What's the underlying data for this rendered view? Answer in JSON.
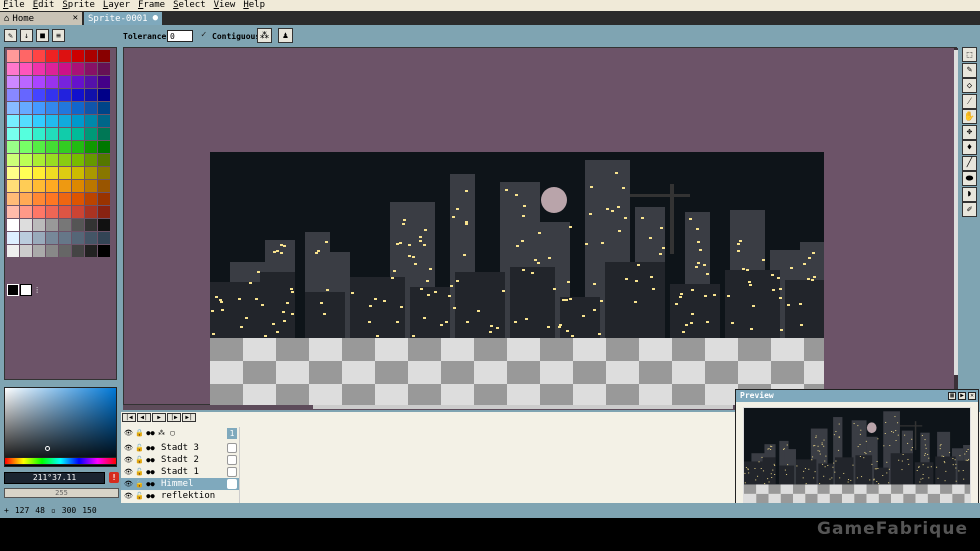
{
  "menu": {
    "items": [
      "File",
      "Edit",
      "Sprite",
      "Layer",
      "Frame",
      "Select",
      "View",
      "Help"
    ]
  },
  "tabs": {
    "home": "Home",
    "sprite": "Sprite-0001"
  },
  "toolbar": {
    "tolerance_label": "Tolerance:",
    "tolerance_value": "0",
    "contiguous_label": "Contiguous"
  },
  "palette": {
    "colors": [
      "#ff9999",
      "#ff6666",
      "#ff4444",
      "#ee2222",
      "#dd1111",
      "#cc0000",
      "#aa0000",
      "#880000",
      "#ff77cc",
      "#ff55bb",
      "#ee33aa",
      "#dd2299",
      "#cc1188",
      "#aa1177",
      "#881166",
      "#661155",
      "#cc88ff",
      "#bb66ff",
      "#aa44ff",
      "#9933ee",
      "#7722dd",
      "#6611cc",
      "#5511aa",
      "#440088",
      "#8888ff",
      "#6666ff",
      "#4444ff",
      "#3333ee",
      "#2222dd",
      "#1111cc",
      "#1111aa",
      "#000088",
      "#88bbff",
      "#66aaff",
      "#4499ff",
      "#3388ee",
      "#2277dd",
      "#1166cc",
      "#1155aa",
      "#004488",
      "#77eeff",
      "#55ddff",
      "#33ccff",
      "#22bbee",
      "#11aadd",
      "#0099cc",
      "#0088aa",
      "#006688",
      "#77ffee",
      "#55ffdd",
      "#33eecc",
      "#22ddbb",
      "#11ccaa",
      "#00bb99",
      "#009977",
      "#007755",
      "#99ff88",
      "#77ff66",
      "#55ee44",
      "#44dd33",
      "#33cc22",
      "#22bb11",
      "#119900",
      "#007700",
      "#ccff77",
      "#bbff55",
      "#aaee33",
      "#99dd22",
      "#88cc11",
      "#77bb00",
      "#669900",
      "#557700",
      "#ffff88",
      "#ffff55",
      "#ffee33",
      "#eedd22",
      "#ddcc11",
      "#ccbb00",
      "#aa9900",
      "#887700",
      "#ffdd77",
      "#ffcc55",
      "#ffbb33",
      "#ffaa22",
      "#ee9911",
      "#dd8800",
      "#bb7700",
      "#995500",
      "#ffbb77",
      "#ffaa55",
      "#ff8833",
      "#ff7722",
      "#ee6611",
      "#dd5500",
      "#bb4400",
      "#993300",
      "#ffbbaa",
      "#ff9988",
      "#ff7766",
      "#ee6655",
      "#dd5544",
      "#cc4433",
      "#aa3322",
      "#882211",
      "#ffffff",
      "#dddddd",
      "#bbbbbb",
      "#999999",
      "#777777",
      "#555555",
      "#333333",
      "#111111",
      "#ddeeff",
      "#bbccdd",
      "#99aabb",
      "#778899",
      "#667788",
      "#556677",
      "#445566",
      "#334455",
      "#eeeeee",
      "#cccccc",
      "#aaaaaa",
      "#888888",
      "#666666",
      "#444444",
      "#222222",
      "#000000"
    ]
  },
  "color": {
    "hsv": "211°37.11",
    "warning": "!",
    "alpha_label": "255"
  },
  "timeline": {
    "frame_number": "1",
    "layers": [
      {
        "name": "Stadt 3"
      },
      {
        "name": "Stadt 2"
      },
      {
        "name": "Stadt 1"
      },
      {
        "name": "Himmel"
      },
      {
        "name": "reflektion"
      }
    ]
  },
  "preview": {
    "title": "Preview"
  },
  "status": {
    "pos_x": "127",
    "pos_y": "48",
    "width": "300",
    "height": "150"
  },
  "watermark": "GameFabrique",
  "colors": {
    "canvas_bg": "#6c5368",
    "ui_blue": "#7fa4b2",
    "accent": "#7fa9bd",
    "night_sky": "#0e1419",
    "window_light": "#f7e28e"
  }
}
